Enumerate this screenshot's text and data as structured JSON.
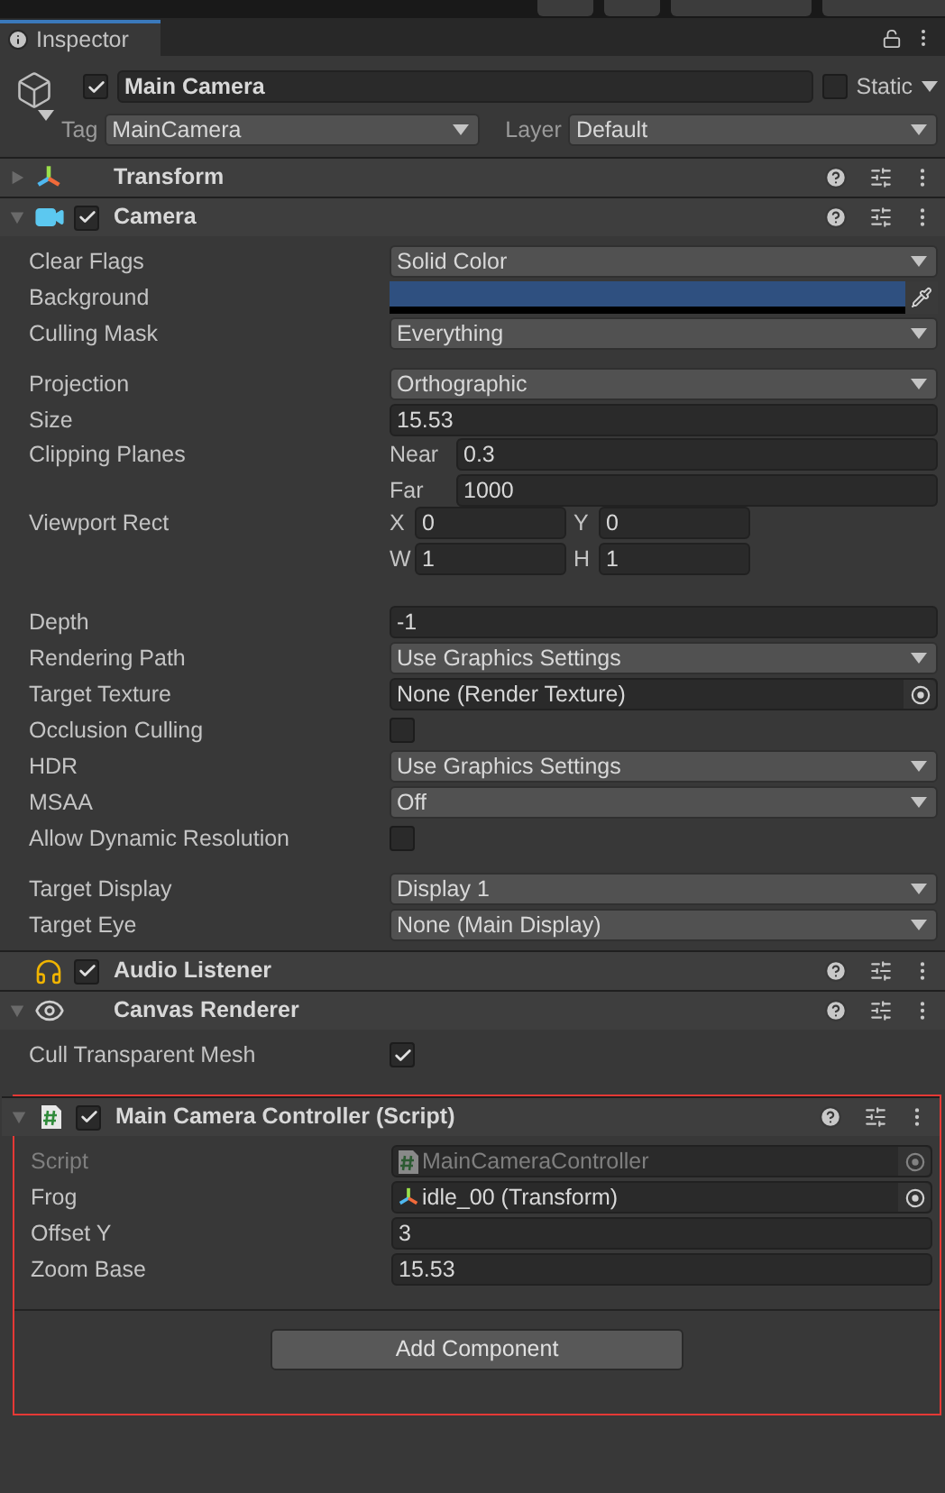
{
  "tab": {
    "title": "Inspector"
  },
  "object": {
    "active": true,
    "name": "Main Camera",
    "static_label": "Static",
    "static": false,
    "tag_label": "Tag",
    "tag": "MainCamera",
    "layer_label": "Layer",
    "layer": "Default"
  },
  "components": [
    {
      "name": "Transform",
      "kind": "transform",
      "expanded": false
    },
    {
      "name": "Camera",
      "kind": "camera",
      "expanded": true,
      "enabled": true,
      "rows": [
        {
          "kind": "dropdown",
          "label": "Clear Flags",
          "value": "Solid Color"
        },
        {
          "kind": "color",
          "label": "Background",
          "color": "#2f5080"
        },
        {
          "kind": "dropdown",
          "label": "Culling Mask",
          "value": "Everything"
        },
        {
          "kind": "gap"
        },
        {
          "kind": "dropdown",
          "label": "Projection",
          "value": "Orthographic"
        },
        {
          "kind": "field",
          "label": "Size",
          "value": "15.53"
        },
        {
          "kind": "pair",
          "label": "Clipping Planes",
          "fields": [
            {
              "label": "Near",
              "value": "0.3"
            },
            {
              "label": "Far",
              "value": "1000"
            }
          ]
        },
        {
          "kind": "rect",
          "label": "Viewport Rect",
          "fields": [
            {
              "label": "X",
              "value": "0"
            },
            {
              "label": "Y",
              "value": "0"
            },
            {
              "label": "W",
              "value": "1"
            },
            {
              "label": "H",
              "value": "1"
            }
          ]
        },
        {
          "kind": "gap"
        },
        {
          "kind": "field",
          "label": "Depth",
          "value": "-1"
        },
        {
          "kind": "dropdown",
          "label": "Rendering Path",
          "value": "Use Graphics Settings"
        },
        {
          "kind": "object",
          "label": "Target Texture",
          "value": "None (Render Texture)",
          "disabled": false
        },
        {
          "kind": "checkbox",
          "label": "Occlusion Culling",
          "checked": false
        },
        {
          "kind": "dropdown",
          "label": "HDR",
          "value": "Use Graphics Settings"
        },
        {
          "kind": "dropdown",
          "label": "MSAA",
          "value": "Off"
        },
        {
          "kind": "checkbox",
          "label": "Allow Dynamic Resolution",
          "checked": false
        },
        {
          "kind": "gap"
        },
        {
          "kind": "dropdown",
          "label": "Target Display",
          "value": "Display 1"
        },
        {
          "kind": "dropdown",
          "label": "Target Eye",
          "value": "None (Main Display)"
        }
      ]
    },
    {
      "name": "Audio Listener",
      "kind": "audio",
      "enabled": true
    },
    {
      "name": "Canvas Renderer",
      "kind": "canvas",
      "expanded": true,
      "rows": [
        {
          "kind": "checkbox",
          "label": "Cull Transparent Mesh",
          "checked": true
        },
        {
          "kind": "gap"
        }
      ]
    },
    {
      "name": "Main Camera Controller (Script)",
      "kind": "script",
      "expanded": true,
      "enabled": true,
      "highlighted": true,
      "rows": [
        {
          "kind": "script_object",
          "label": "Script",
          "value": "MainCameraController",
          "disabled": true
        },
        {
          "kind": "transform_object",
          "label": "Frog",
          "value": "idle_00 (Transform)",
          "disabled": false
        },
        {
          "kind": "field",
          "label": "Offset Y",
          "value": "3"
        },
        {
          "kind": "field",
          "label": "Zoom Base",
          "value": "15.53"
        }
      ]
    }
  ],
  "add_component": {
    "label": "Add Component",
    "highlighted": true
  }
}
